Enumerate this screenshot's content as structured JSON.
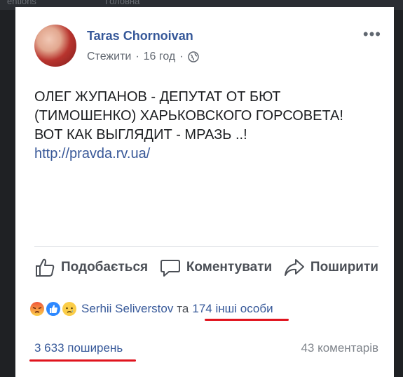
{
  "post": {
    "author": "Taras Chornoivan",
    "follow_label": "Стежити",
    "separator": "·",
    "time": "16 год",
    "more_label": "•••",
    "text_lines": [
      "ОЛЕГ ЖУПАНОВ - ДЕПУТАТ ОТ БЮТ",
      "(ТИМОШЕНКО) ХАРЬКОВСКОГО ГОРСОВЕТА!",
      "ВОТ КАК ВЫГЛЯДИТ - МРАЗЬ ..!"
    ],
    "link": "http://pravda.rv.ua/"
  },
  "actions": {
    "like": "Подобається",
    "comment": "Коментувати",
    "share": "Поширити"
  },
  "reactions": {
    "icons": [
      "angry-icon",
      "like-icon",
      "sad-icon"
    ],
    "names": "Serhii Seliverstov",
    "and": "та",
    "others": "174 інші особи"
  },
  "stats": {
    "shares": "3 633 поширень",
    "comments": "43 коментарів"
  },
  "colors": {
    "name_blue": "#365899",
    "underline_red": "#e0141e",
    "action_gray": "#4b4f56"
  }
}
